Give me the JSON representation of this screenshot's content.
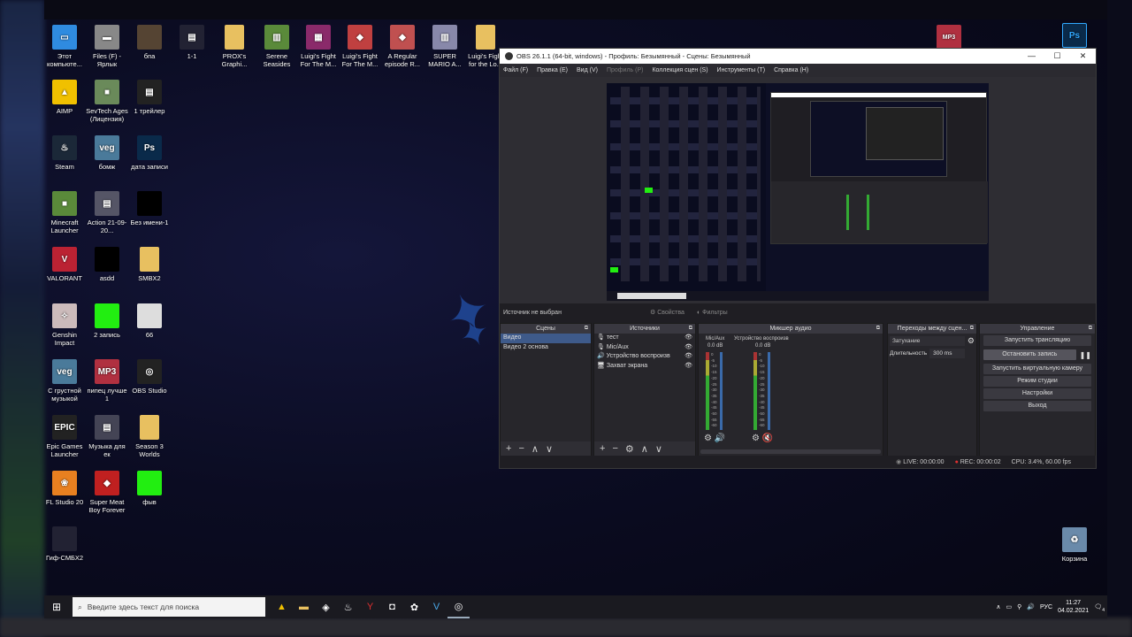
{
  "colors": {
    "accent": "#3e5a8a",
    "rec": "#e03030",
    "green": "#22ee11"
  },
  "desktop": {
    "icons": [
      {
        "label": "Этот компьюте...",
        "icon": "computer-icon",
        "color": "#2f8be0"
      },
      {
        "label": "Files (F) - Ярлык",
        "icon": "drive-icon",
        "color": "#888"
      },
      {
        "label": "бпа",
        "icon": "image-icon",
        "color": "#554433"
      },
      {
        "label": "1-1",
        "icon": "video-icon",
        "color": "#223"
      },
      {
        "label": "PROX's Graphi...",
        "icon": "folder-icon",
        "color": "#e8c060"
      },
      {
        "label": "Serene Seasides",
        "icon": "archive-icon",
        "color": "#5a8a3a"
      },
      {
        "label": "Luigi's Fight For The M...",
        "icon": "winrar-icon",
        "color": "#8a2a6a"
      },
      {
        "label": "Luigi's Fight For The M...",
        "icon": "game-icon",
        "color": "#c04040"
      },
      {
        "label": "A Regular episode R...",
        "icon": "game-icon",
        "color": "#c05050"
      },
      {
        "label": "SUPER MARIO A...",
        "icon": "archive-icon",
        "color": "#8888aa"
      },
      {
        "label": "Luigi's Fight for the Lo...",
        "icon": "folder-icon",
        "color": "#e8c060"
      },
      {
        "label": "AIMP",
        "icon": "aimp-icon",
        "color": "#f0c000"
      },
      {
        "label": "SevTech Ages (Лицензия)",
        "icon": "minecraft-icon",
        "color": "#6a8a5a"
      },
      {
        "label": "1 трейлер",
        "icon": "video-icon",
        "color": "#222"
      },
      {
        "label": "Steam",
        "icon": "steam-icon",
        "color": "#1b2838"
      },
      {
        "label": "бомж",
        "icon": "vegas-icon",
        "color": "#4a7a9a"
      },
      {
        "label": "дата записи",
        "icon": "photoshop-icon",
        "color": "#0a2a4a"
      },
      {
        "label": "Minecraft Launcher",
        "icon": "minecraft-icon",
        "color": "#5a8a3a"
      },
      {
        "label": "Action 21-09-20...",
        "icon": "video-icon",
        "color": "#556"
      },
      {
        "label": "Без имени-1",
        "icon": "image-icon",
        "color": "#000"
      },
      {
        "label": "VALORANT",
        "icon": "valorant-icon",
        "color": "#bb2233"
      },
      {
        "label": "asdd",
        "icon": "image-icon",
        "color": "#000"
      },
      {
        "label": "SMBX2",
        "icon": "folder-icon",
        "color": "#e8c060"
      },
      {
        "label": "Genshin Impact",
        "icon": "genshin-icon",
        "color": "#cbb"
      },
      {
        "label": "2 запись",
        "icon": "image-icon",
        "color": "#22ee11"
      },
      {
        "label": "66",
        "icon": "image-icon",
        "color": "#ddd"
      },
      {
        "label": "С грустной музыкой",
        "icon": "vegas-icon",
        "color": "#4a7a9a"
      },
      {
        "label": "пипец лучше 1",
        "icon": "mp3-icon",
        "color": "#b03040"
      },
      {
        "label": "OBS Studio",
        "icon": "obs-icon",
        "color": "#222"
      },
      {
        "label": "Epic Games Launcher",
        "icon": "epic-icon",
        "color": "#222"
      },
      {
        "label": "Музыка для ек",
        "icon": "video-icon",
        "color": "#445"
      },
      {
        "label": "Season 3 Worlds",
        "icon": "folder-icon",
        "color": "#e8c060"
      },
      {
        "label": "FL Studio 20",
        "icon": "fl-studio-icon",
        "color": "#e88020"
      },
      {
        "label": "Super Meat Boy Forever",
        "icon": "game-icon",
        "color": "#c02020"
      },
      {
        "label": "фыв",
        "icon": "image-icon",
        "color": "#22ee11"
      },
      {
        "label": "Гиф-СМБХ2",
        "icon": "image-icon",
        "color": "#223"
      }
    ],
    "right_icons": [
      {
        "label": "MP3",
        "icon": "mp3-icon"
      },
      {
        "label": "Ps",
        "icon": "photoshop-icon"
      }
    ],
    "recycle_bin": "Корзина"
  },
  "obs": {
    "title": "OBS 26.1.1 (64-bit, windows) - Профиль: Безымянный - Сцены: Безымянный",
    "menu": [
      "Файл (F)",
      "Правка (E)",
      "Вид (V)",
      "Профиль (P)",
      "Коллекция сцен (S)",
      "Инструменты (T)",
      "Справка (H)"
    ],
    "no_source": "Источник не выбран",
    "properties": "Свойства",
    "filters": "Фильтры",
    "docks": {
      "scenes": {
        "title": "Сцены",
        "items": [
          "Видео",
          "Видео 2 основа"
        ]
      },
      "sources": {
        "title": "Источники",
        "items": [
          "тест",
          "Mic/Aux",
          "Устройство воспроизв",
          "Захват экрана"
        ]
      },
      "mixer": {
        "title": "Микшер аудио",
        "channels": [
          {
            "name": "Mic/Aux",
            "db": "0.0 dB"
          },
          {
            "name": "Устройство воспроизв",
            "db": "0.0 dB"
          }
        ],
        "scale": [
          "0",
          "-5",
          "-10",
          "-15",
          "-20",
          "-25",
          "-30",
          "-35",
          "-40",
          "-45",
          "-50",
          "-55",
          "-60"
        ]
      },
      "transitions": {
        "title": "Переходы между сцен...",
        "type": "Затухание",
        "duration_label": "Длительность",
        "duration": "300 ms"
      },
      "controls": {
        "title": "Управление",
        "buttons": [
          "Запустить трансляцию",
          "Остановить запись",
          "Запустить виртуальную камеру",
          "Режим студии",
          "Настройки",
          "Выход"
        ]
      }
    },
    "status": {
      "live": "LIVE: 00:00:00",
      "rec": "REC: 00:00:02",
      "cpu": "CPU: 3.4%, 60.00 fps"
    }
  },
  "taskbar": {
    "search_placeholder": "Введите здесь текст для поиска",
    "lang": "РУС",
    "time": "11:27",
    "date": "04.02.2021",
    "notif_count": "4"
  }
}
